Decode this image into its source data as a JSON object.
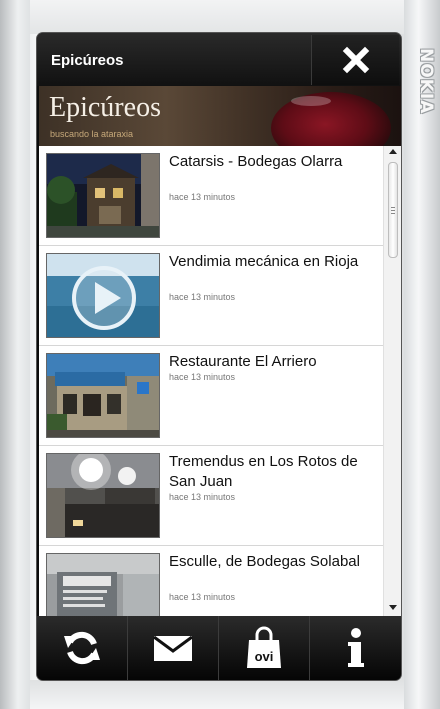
{
  "device": {
    "brand": "NOKIA"
  },
  "header": {
    "app_title": "Epicúreos",
    "close_icon": "close-icon"
  },
  "banner": {
    "title": "Epicúreos",
    "subtitle": "buscando la ataraxia"
  },
  "posts": [
    {
      "title": "Catarsis - Bodegas Olarra",
      "time": "hace 13 minutos",
      "thumb": "photo-bodega-night"
    },
    {
      "title": "Vendimia mecánica en Rioja",
      "time": "hace 13 minutos",
      "thumb": "video-thumbnail-play"
    },
    {
      "title": "Restaurante El Arriero",
      "time": "hace 13 minutos",
      "thumb": "photo-restaurant-front"
    },
    {
      "title": "Tremendus en Los Rotos de San Juan",
      "time": "hace 13 minutos",
      "thumb": "photo-bar-lights"
    },
    {
      "title": "Esculle, de Bodegas Solabal",
      "time": "hace 13 minutos",
      "thumb": "photo-bodega-sign"
    }
  ],
  "toolbar": {
    "buttons": [
      {
        "name": "refresh",
        "icon": "refresh-icon"
      },
      {
        "name": "mail",
        "icon": "mail-icon"
      },
      {
        "name": "ovi-store",
        "icon": "ovi-bag-icon",
        "label": "ovi"
      },
      {
        "name": "info",
        "icon": "info-icon"
      }
    ]
  },
  "colors": {
    "screen_bg": "#0b0b0b",
    "list_bg": "#ffffff",
    "banner_wine": "#8a1624",
    "subtitle": "#c7a97a"
  }
}
